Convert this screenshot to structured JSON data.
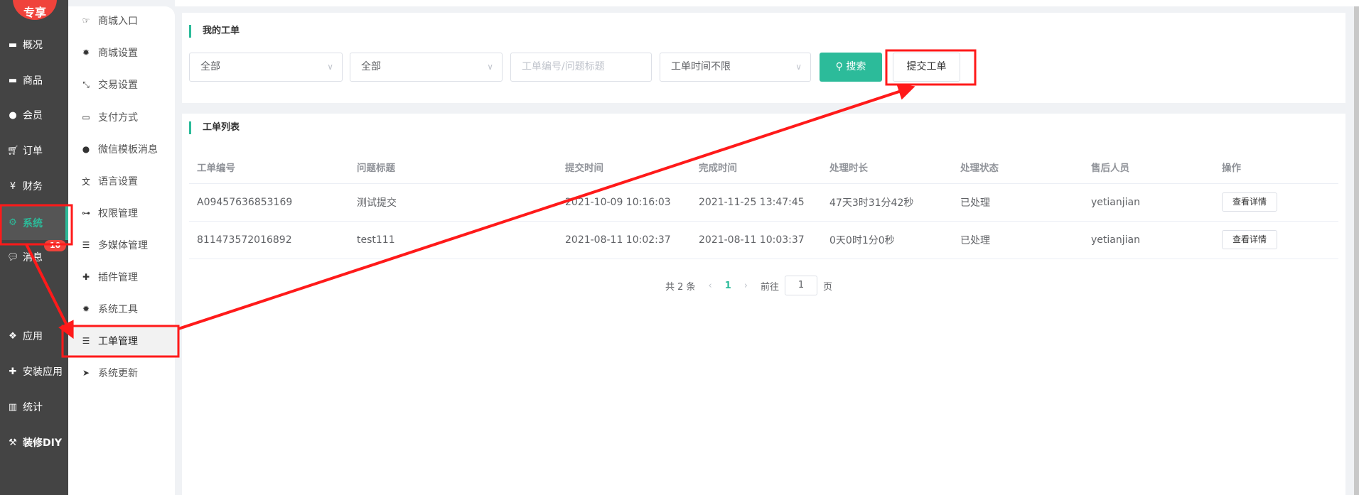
{
  "logo": {
    "text": "专享"
  },
  "sidebar": {
    "items": [
      {
        "label": "概况",
        "icon": "archive-icon"
      },
      {
        "label": "商品",
        "icon": "archive-icon"
      },
      {
        "label": "会员",
        "icon": "users-icon"
      },
      {
        "label": "订单",
        "icon": "cart-icon"
      },
      {
        "label": "财务",
        "icon": "yen-icon"
      },
      {
        "label": "系统",
        "icon": "gears-icon"
      },
      {
        "label": "消息",
        "icon": "comment-icon"
      },
      {
        "label": "应用",
        "icon": "cubes-icon"
      },
      {
        "label": "安装应用",
        "icon": "puzzle-icon"
      },
      {
        "label": "统计",
        "icon": "bar-chart-icon"
      },
      {
        "label": "装修DIY",
        "icon": "hammer-icon"
      }
    ],
    "message_badge": "10",
    "active": "系统"
  },
  "submenu": {
    "items": [
      {
        "label": "商城入口",
        "icon": "hand-point-icon"
      },
      {
        "label": "商城设置",
        "icon": "gear-icon"
      },
      {
        "label": "交易设置",
        "icon": "compress-icon"
      },
      {
        "label": "支付方式",
        "icon": "credit-card-icon"
      },
      {
        "label": "微信模板消息",
        "icon": "wechat-icon"
      },
      {
        "label": "语言设置",
        "icon": "language-icon"
      },
      {
        "label": "权限管理",
        "icon": "gamepad-icon"
      },
      {
        "label": "多媒体管理",
        "icon": "list-icon"
      },
      {
        "label": "插件管理",
        "icon": "puzzle-icon"
      },
      {
        "label": "系统工具",
        "icon": "gear-icon"
      },
      {
        "label": "工单管理",
        "icon": "list-icon"
      },
      {
        "label": "系统更新",
        "icon": "paper-plane-icon"
      }
    ],
    "active": "工单管理"
  },
  "my_tickets": {
    "title": "我的工单",
    "filter1": "全部",
    "filter2": "全部",
    "search_placeholder": "工单编号/问题标题",
    "time_filter": "工单时间不限",
    "search_label": "搜索",
    "submit_label": "提交工单"
  },
  "ticket_list": {
    "title": "工单列表",
    "columns": [
      "工单编号",
      "问题标题",
      "提交时间",
      "完成时间",
      "处理时长",
      "处理状态",
      "售后人员",
      "操作"
    ],
    "rows": [
      [
        "A09457636853169",
        "测试提交",
        "2021-10-09 10:16:03",
        "2021-11-25 13:47:45",
        "47天3时31分42秒",
        "已处理",
        "yetianjian",
        "查看详情"
      ],
      [
        "811473572016892",
        "test111",
        "2021-08-11 10:02:37",
        "2021-08-11 10:03:37",
        "0天0时1分0秒",
        "已处理",
        "yetianjian",
        "查看详情"
      ]
    ]
  },
  "pagination": {
    "total": "共 2 条",
    "current": "1",
    "goto_label": "前往",
    "goto_value": "1",
    "page_suffix": "页"
  },
  "colors": {
    "accent": "#2cbb9a",
    "sidebar": "#444444",
    "annotation": "#ff1a1a"
  }
}
